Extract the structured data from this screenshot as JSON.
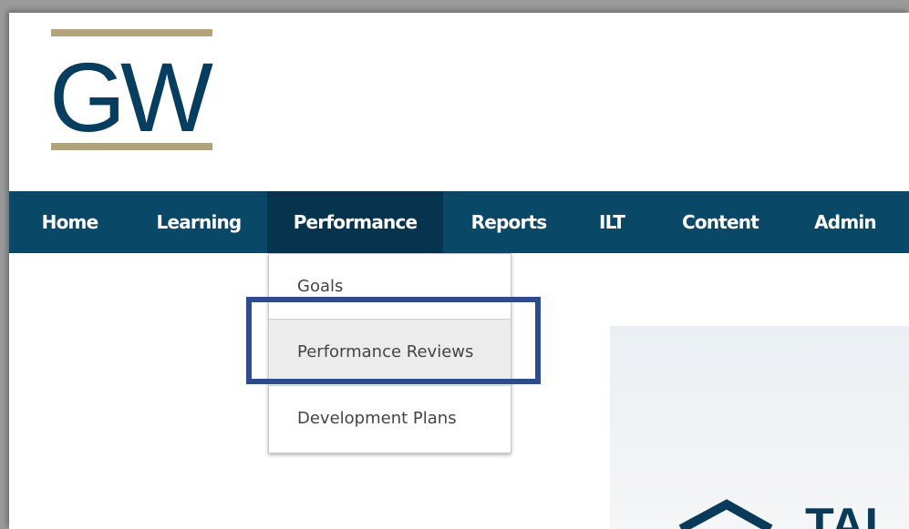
{
  "logo": {
    "text": "GW",
    "colors": {
      "text": "#073e5f",
      "bars": "#b3a37a"
    }
  },
  "nav": {
    "items": [
      {
        "label": "Home"
      },
      {
        "label": "Learning"
      },
      {
        "label": "Performance",
        "active": true
      },
      {
        "label": "Reports"
      },
      {
        "label": "ILT"
      },
      {
        "label": "Content"
      },
      {
        "label": "Admin"
      }
    ],
    "colors": {
      "bar": "#0a4868",
      "active": "#06344f"
    }
  },
  "dropdown": {
    "items": [
      {
        "label": "Goals"
      },
      {
        "label": "Performance Reviews",
        "highlighted": true
      },
      {
        "label": "Development Plans"
      }
    ]
  },
  "annotation": {
    "color": "#2c4c8f",
    "target": "Performance Reviews"
  },
  "hero": {
    "partial_text": "TAL"
  }
}
